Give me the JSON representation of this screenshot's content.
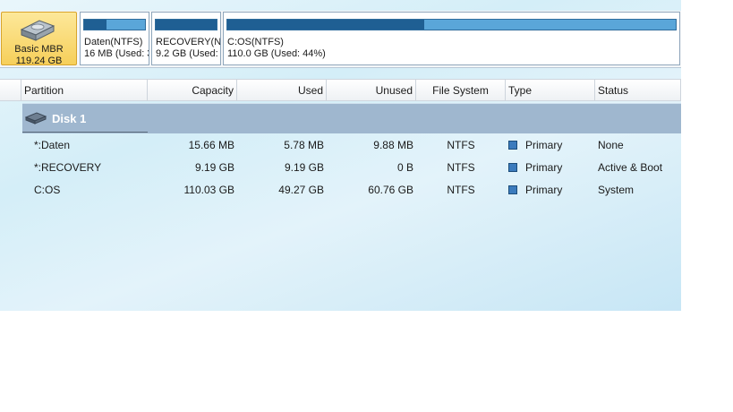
{
  "disk_map": {
    "disk": {
      "name": "Basic MBR",
      "size": "119.24 GB"
    },
    "partitions": [
      {
        "label": "Daten(NTFS)",
        "detail": "16 MB (Used: 3",
        "used_fraction": 0.37
      },
      {
        "label": "RECOVERY(NT",
        "detail": "9.2 GB (Used:",
        "used_fraction": 1.0
      },
      {
        "label": "C:OS(NTFS)",
        "detail": "110.0 GB (Used: 44%)",
        "used_fraction": 0.44
      }
    ]
  },
  "columns": {
    "partition": "Partition",
    "capacity": "Capacity",
    "used": "Used",
    "unused": "Unused",
    "file_system": "File System",
    "type": "Type",
    "status": "Status"
  },
  "disk_row": {
    "label": "Disk 1"
  },
  "rows": [
    {
      "partition": "*:Daten",
      "capacity": "15.66 MB",
      "used": "5.78 MB",
      "unused": "9.88 MB",
      "fs": "NTFS",
      "type": "Primary",
      "status": "None"
    },
    {
      "partition": "*:RECOVERY",
      "capacity": "9.19 GB",
      "used": "9.19 GB",
      "unused": "0 B",
      "fs": "NTFS",
      "type": "Primary",
      "status": "Active & Boot"
    },
    {
      "partition": "C:OS",
      "capacity": "110.03 GB",
      "used": "49.27 GB",
      "unused": "60.76 GB",
      "fs": "NTFS",
      "type": "Primary",
      "status": "System"
    }
  ],
  "colors": {
    "selected_card": "#f6cf5a",
    "bar_fill": "#1f5f93",
    "bar_empty": "#5aa6d9",
    "disk_row": "#9fb7cf"
  }
}
